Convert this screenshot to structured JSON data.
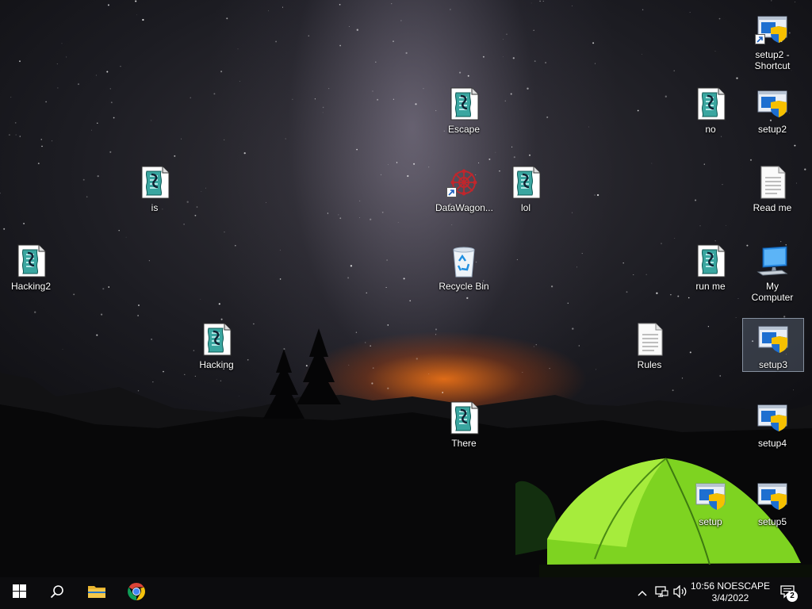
{
  "desktop": {
    "icons": [
      {
        "label": "setup2 - Shortcut",
        "type": "installer",
        "shortcut": true
      },
      {
        "label": "Escape",
        "type": "script"
      },
      {
        "label": "no",
        "type": "script"
      },
      {
        "label": "setup2",
        "type": "installer"
      },
      {
        "label": "is",
        "type": "script"
      },
      {
        "label": "DataWagon...",
        "type": "app",
        "shortcut": true
      },
      {
        "label": "lol",
        "type": "script"
      },
      {
        "label": "Read me",
        "type": "text-file"
      },
      {
        "label": "Hacking2",
        "type": "script"
      },
      {
        "label": "Recycle Bin",
        "type": "recycle-bin"
      },
      {
        "label": "run me",
        "type": "script"
      },
      {
        "label": "My Computer",
        "type": "computer"
      },
      {
        "label": "Hacking",
        "type": "script"
      },
      {
        "label": "Rules",
        "type": "text-file"
      },
      {
        "label": "setup3",
        "type": "installer",
        "selected": true
      },
      {
        "label": "There",
        "type": "script"
      },
      {
        "label": "setup4",
        "type": "installer"
      },
      {
        "label": "setup",
        "type": "installer"
      },
      {
        "label": "setup5",
        "type": "installer"
      }
    ]
  },
  "taskbar": {
    "pinned": [
      {
        "name": "start",
        "icon": "windows-logo-icon"
      },
      {
        "name": "search",
        "icon": "search-icon"
      },
      {
        "name": "file-explorer",
        "icon": "folder-icon"
      },
      {
        "name": "chrome",
        "icon": "chrome-icon"
      }
    ],
    "tray": {
      "time_line": "10:56 NOESCAPE",
      "date": "3/4/2022",
      "notification_count": "2"
    }
  },
  "colors": {
    "taskbar": "#0c0c0e",
    "tent_green": "#8fdd2a",
    "horizon_glow": "#ff7a14",
    "accent_blue": "#1e6fd0"
  }
}
